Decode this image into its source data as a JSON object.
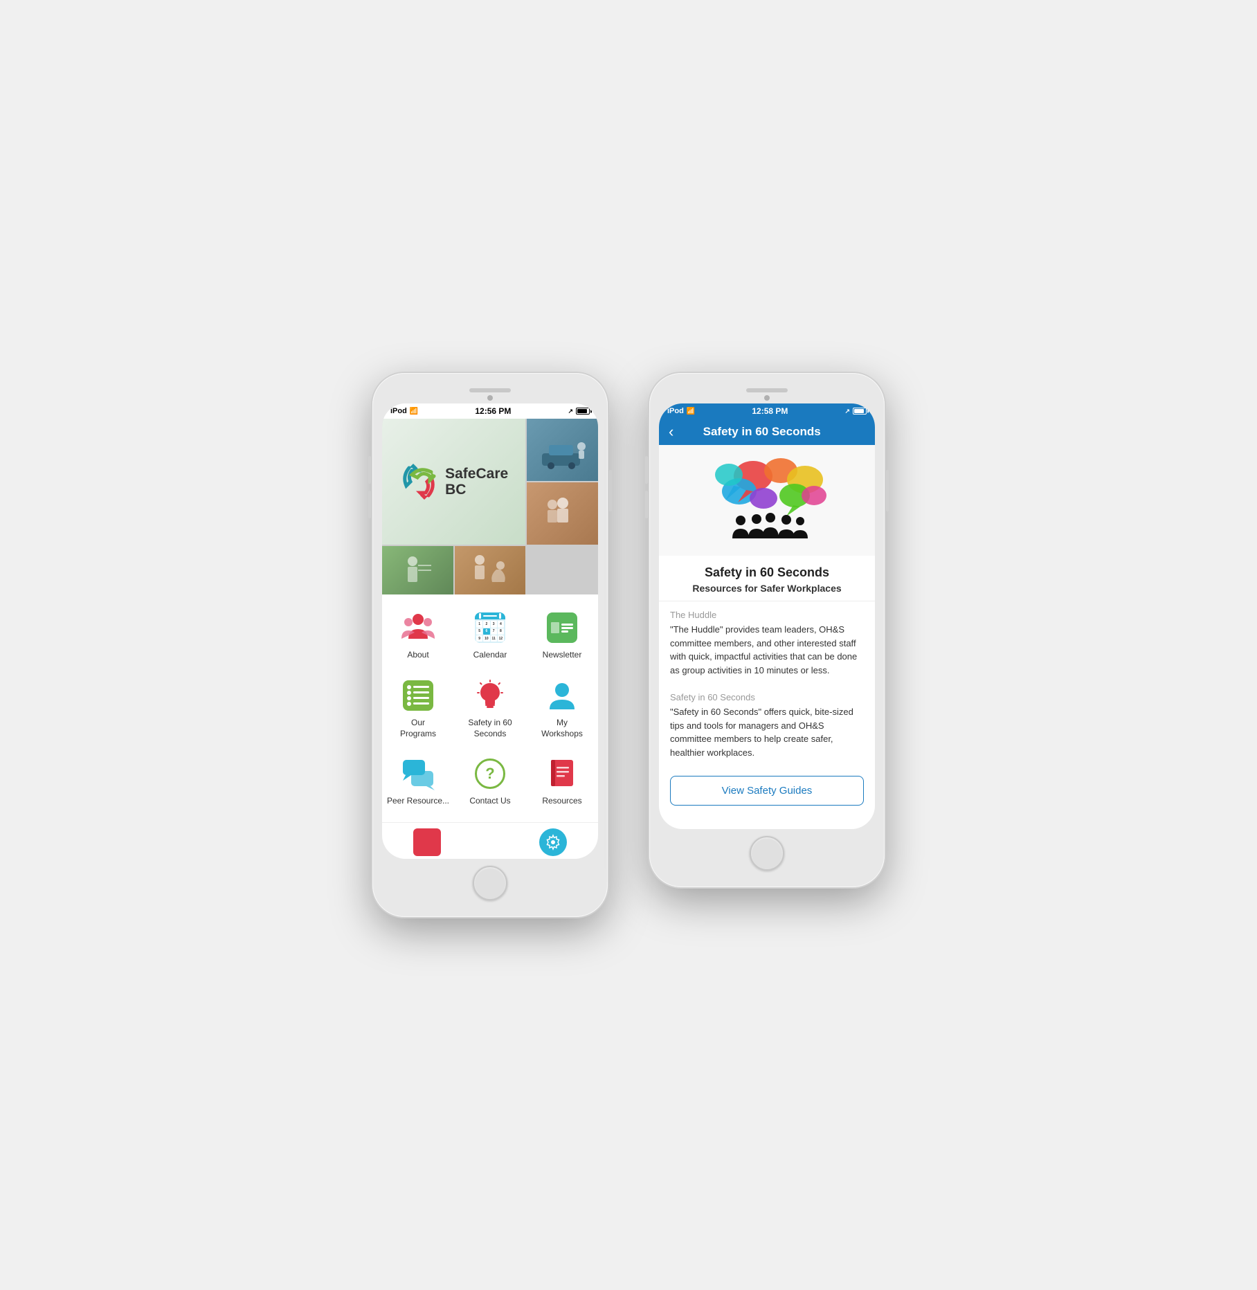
{
  "phone1": {
    "status": {
      "device": "iPod",
      "wifi": "wifi",
      "time": "12:56 PM",
      "arrow": "↗",
      "battery": "battery"
    },
    "logo": {
      "text_line1": "SafeCare",
      "text_line2": "BC"
    },
    "menu": {
      "items": [
        {
          "id": "about",
          "label": "About",
          "icon": "about"
        },
        {
          "id": "calendar",
          "label": "Calendar",
          "icon": "calendar"
        },
        {
          "id": "newsletter",
          "label": "Newsletter",
          "icon": "newsletter"
        },
        {
          "id": "programs",
          "label": "Our\nPrograms",
          "icon": "programs"
        },
        {
          "id": "safety60",
          "label": "Safety in 60\nSeconds",
          "icon": "safety60"
        },
        {
          "id": "myworkshops",
          "label": "My\nWorkshops",
          "icon": "myworkshops"
        },
        {
          "id": "peer",
          "label": "Peer\nResource...",
          "icon": "peer"
        },
        {
          "id": "contact",
          "label": "Contact Us",
          "icon": "contact"
        },
        {
          "id": "resources",
          "label": "Resources",
          "icon": "resources"
        }
      ]
    }
  },
  "phone2": {
    "status": {
      "device": "iPod",
      "wifi": "wifi",
      "time": "12:58 PM",
      "arrow": "↗",
      "battery": "battery"
    },
    "header": {
      "back_label": "‹",
      "title": "Safety in 60 Seconds"
    },
    "detail": {
      "main_title": "Safety in 60 Seconds",
      "subtitle": "Resources for Safer Workplaces",
      "sections": [
        {
          "label": "The Huddle",
          "text": "\"The Huddle\" provides team leaders, OH&S committee members, and other interested staff with quick, impactful activities that can be done as group activities in 10 minutes or less."
        },
        {
          "label": "Safety in 60 Seconds",
          "text": "\"Safety in 60 Seconds\" offers quick, bite-sized tips and tools for managers and OH&S committee members to help create safer, healthier workplaces."
        }
      ],
      "button_label": "View Safety Guides"
    }
  }
}
